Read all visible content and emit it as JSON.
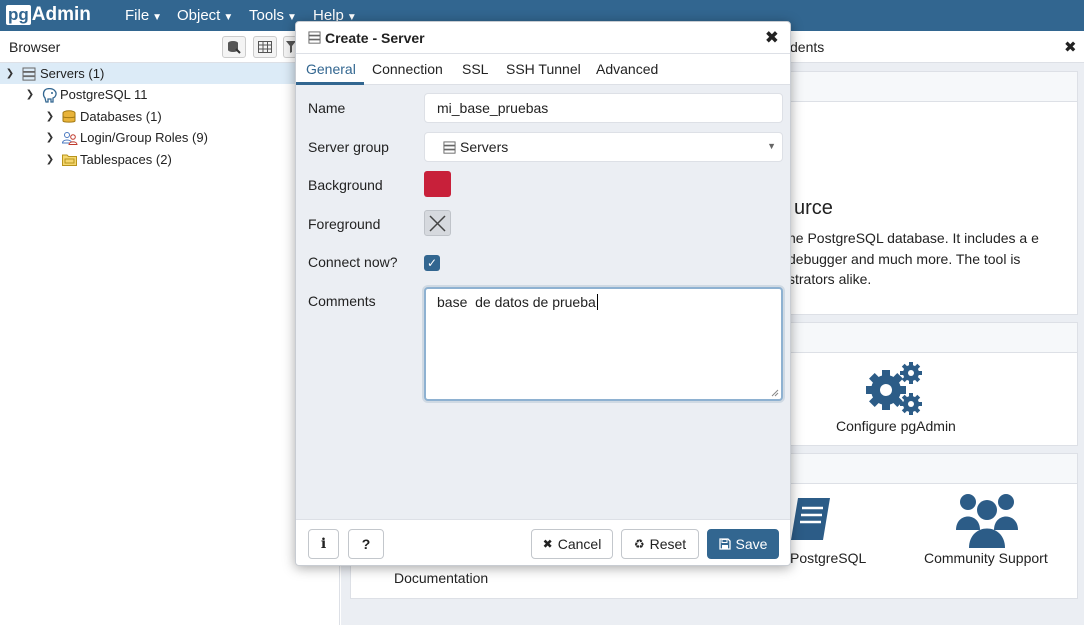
{
  "app": {
    "logo_pg": "pg",
    "logo_admin": "Admin",
    "menu": [
      {
        "label": "File"
      },
      {
        "label": "Object"
      },
      {
        "label": "Tools"
      },
      {
        "label": "Help"
      }
    ]
  },
  "browser": {
    "title": "Browser",
    "tree": [
      {
        "label": "Servers (1)",
        "icon": "servers-icon"
      },
      {
        "label": "PostgreSQL 11",
        "icon": "elephant-icon"
      },
      {
        "label": "Databases (1)",
        "icon": "database-icon"
      },
      {
        "label": "Login/Group Roles (9)",
        "icon": "roles-icon"
      },
      {
        "label": "Tablespaces (2)",
        "icon": "folder-icon"
      }
    ]
  },
  "dashboard": {
    "tab_label_partial": "dents",
    "welcome_title_partial": "urce",
    "welcome_text_partial": "ne PostgreSQL database. It includes a e debugger and much more. The tool is strators alike.",
    "configure_label": "Configure pgAdmin",
    "postgresql_label": "PostgreSQL",
    "community_label": "Community Support",
    "documentation_label": "Documentation"
  },
  "dialog": {
    "title": "Create - Server",
    "tabs": [
      "General",
      "Connection",
      "SSL",
      "SSH Tunnel",
      "Advanced"
    ],
    "active_tab": "General",
    "fields": {
      "name_label": "Name",
      "name_value": "mi_base_pruebas",
      "server_group_label": "Server group",
      "server_group_value": "Servers",
      "background_label": "Background",
      "background_color": "#c8203a",
      "foreground_label": "Foreground",
      "connect_now_label": "Connect now?",
      "connect_now_checked": true,
      "comments_label": "Comments",
      "comments_value": "base  de datos de prueba"
    },
    "footer": {
      "info_label": "i",
      "help_label": "?",
      "cancel_label": "Cancel",
      "reset_label": "Reset",
      "save_label": "Save"
    }
  },
  "colors": {
    "brand": "#326690",
    "panel_bg": "#ebeef3",
    "selected_row": "#dcebf7"
  }
}
